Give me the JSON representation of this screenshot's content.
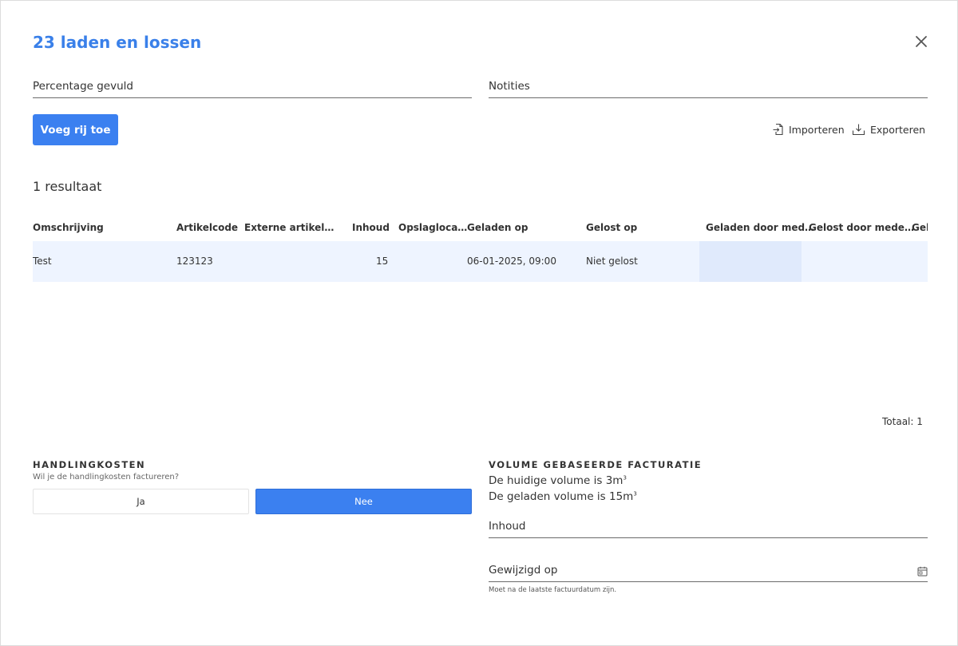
{
  "dialog": {
    "title": "23 laden en lossen",
    "close_icon": "close-icon"
  },
  "fields": {
    "percentage_label": "Percentage gevuld",
    "notes_label": "Notities"
  },
  "toolbar": {
    "add_row_label": "Voeg rij toe",
    "import_label": "Importeren",
    "import_icon": "import-file-icon",
    "export_label": "Exporteren",
    "export_icon": "download-tray-icon"
  },
  "results_label": "1 resultaat",
  "table": {
    "headers": [
      "Omschrijving",
      "Artikelcode",
      "Externe artikel…",
      "Inhoud",
      "Opslagloca…",
      "Geladen op",
      "Gelost op",
      "Geladen door med…",
      "Gelost door mede…",
      "Gel"
    ],
    "rows": [
      [
        "Test",
        "123123",
        "",
        "15",
        "",
        "06-01-2025, 09:00",
        "Niet gelost",
        "",
        "",
        ""
      ]
    ]
  },
  "total_label": "Totaal: 1",
  "handling": {
    "title": "HANDLINGKOSTEN",
    "subtitle": "Wil je de handlingkosten factureren?",
    "option_yes": "Ja",
    "option_no": "Nee",
    "selected": "Nee"
  },
  "volume": {
    "title": "VOLUME GEBASEERDE FACTURATIE",
    "current_text": "De huidige volume is 3m",
    "loaded_text": "De geladen volume is 15m",
    "unit_superscript": "3",
    "inhoud_label": "Inhoud",
    "modified_label": "Gewijzigd op",
    "calendar_icon": "calendar-icon",
    "hint": "Moet na de laatste factuurdatum zijn."
  },
  "colors": {
    "accent": "#3b80f0",
    "title": "#3a80e9",
    "row_bg": "#eef4ff"
  }
}
